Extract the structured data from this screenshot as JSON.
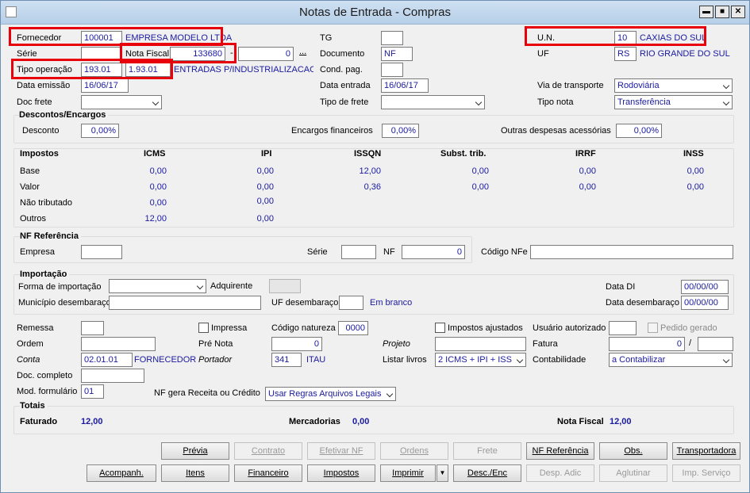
{
  "window": {
    "title": "Notas de Entrada - Compras",
    "min": "▬",
    "max": "■",
    "close": "✕"
  },
  "header": {
    "fornecedor_label": "Fornecedor",
    "fornecedor_code": "100001",
    "fornecedor_name": "EMPRESA MODELO LTDA",
    "serie_label": "Série",
    "serie_value": "",
    "nota_fiscal_label": "Nota Fiscal",
    "nota_fiscal_value": "133680",
    "nf_sep": "-",
    "nf_seq": "0",
    "ellipsis": "...",
    "tipo_operacao_label": "Tipo operação",
    "tipo_operacao_code": "193.01",
    "tipo_operacao_code2": "1.93.01",
    "tipo_operacao_desc": "ENTRADAS P/INDUSTRIALIZACAO P/",
    "data_emissao_label": "Data emissão",
    "data_emissao_value": "16/06/17",
    "doc_frete_label": "Doc frete",
    "doc_frete_value": "",
    "tg_label": "TG",
    "tg_value": "",
    "documento_label": "Documento",
    "documento_value": "NF",
    "cond_pag_label": "Cond. pag.",
    "cond_pag_value": "",
    "data_entrada_label": "Data entrada",
    "data_entrada_value": "16/06/17",
    "tipo_frete_label": "Tipo de frete",
    "tipo_frete_value": "",
    "un_label": "U.N.",
    "un_code": "10",
    "un_name": "CAXIAS DO SUL",
    "uf_label": "UF",
    "uf_code": "RS",
    "uf_name": "RIO GRANDE DO SUL",
    "via_transporte_label": "Via de transporte",
    "via_transporte_value": "Rodoviária",
    "tipo_nota_label": "Tipo nota",
    "tipo_nota_value": "Transferência"
  },
  "descontos": {
    "title": "Descontos/Encargos",
    "desconto_label": "Desconto",
    "desconto_value": "0,00%",
    "encargos_label": "Encargos financeiros",
    "encargos_value": "0,00%",
    "outras_label": "Outras despesas acessórias",
    "outras_value": "0,00%"
  },
  "impostos": {
    "title": "Impostos",
    "columns": [
      "ICMS",
      "IPI",
      "ISSQN",
      "Subst. trib.",
      "IRRF",
      "INSS"
    ],
    "row_labels": [
      "Base",
      "Valor",
      "Não tributado",
      "Outros"
    ],
    "rows": [
      [
        "0,00",
        "0,00",
        "12,00",
        "0,00",
        "0,00",
        "0,00"
      ],
      [
        "0,00",
        "0,00",
        "0,36",
        "0,00",
        "0,00",
        "0,00"
      ],
      [
        "0,00",
        "0,00"
      ],
      [
        "12,00",
        "0,00"
      ]
    ]
  },
  "nf_referencia": {
    "title": "NF Referência",
    "empresa_label": "Empresa",
    "empresa_value": "",
    "serie_label": "Série",
    "serie_value": "",
    "nf_label": "NF",
    "nf_value": "0",
    "codigo_nfe_label": "Código NFe",
    "codigo_nfe_value": ""
  },
  "importacao": {
    "title": "Importação",
    "forma_label": "Forma de importação",
    "forma_value": "",
    "adquirente_label": "Adquirente",
    "adquirente_value": "",
    "data_di_label": "Data DI",
    "data_di_value": "00/00/00",
    "municipio_label": "Município desembaraço",
    "municipio_value": "",
    "uf_desemb_label": "UF desembaraço",
    "uf_desemb_value": "",
    "uf_desemb_desc": "Em branco",
    "data_desemb_label": "Data desembaraço",
    "data_desemb_value": "00/00/00"
  },
  "misc": {
    "remessa_label": "Remessa",
    "remessa_value": "",
    "impressa_label": "Impressa",
    "codigo_natureza_label": "Código natureza",
    "codigo_natureza_value": "0000",
    "impostos_ajustados_label": "Impostos ajustados",
    "usuario_autorizado_label": "Usuário autorizado",
    "usuario_autorizado_value": "",
    "pedido_gerado_label": "Pedido gerado",
    "ordem_label": "Ordem",
    "ordem_value": "",
    "pre_nota_label": "Pré Nota",
    "pre_nota_value": "0",
    "projeto_label": "Projeto",
    "projeto_value": "",
    "fatura_label": "Fatura",
    "fatura_value": "0",
    "fatura_sep": "/",
    "fatura_value2": "",
    "conta_label": "Conta",
    "conta_value": "02.01.01",
    "conta_desc": "FORNECEDOR",
    "portador_label": "Portador",
    "portador_value": "341",
    "portador_desc": "ITAU",
    "listar_livros_label": "Listar livros",
    "listar_livros_value": "2 ICMS + IPI + ISS",
    "contabilidade_label": "Contabilidade",
    "contabilidade_value": "a Contabilizar",
    "doc_completo_label": "Doc. completo",
    "doc_completo_value": "",
    "mod_formulario_label": "Mod. formulário",
    "mod_formulario_value": "01",
    "nf_gera_label": "NF gera Receita ou Crédito",
    "nf_gera_value": "Usar Regras Arquivos Legais"
  },
  "totais": {
    "title": "Totais",
    "faturado_label": "Faturado",
    "faturado_value": "12,00",
    "mercadorias_label": "Mercadorias",
    "mercadorias_value": "0,00",
    "nota_fiscal_label": "Nota Fiscal",
    "nota_fiscal_value": "12,00"
  },
  "buttons": {
    "previa": "Prévia",
    "contrato": "Contrato",
    "efetivar_nf": "Efetivar NF",
    "ordens": "Ordens",
    "frete": "Frete",
    "nf_referencia": "NF Referência",
    "obs": "Obs.",
    "transportadora": "Transportadora",
    "acompanh": "Acompanh.",
    "itens": "Itens",
    "financeiro": "Financeiro",
    "impostos": "Impostos",
    "imprimir": "Imprimir",
    "desc_enc": "Desc./Enc",
    "desp_adic": "Desp. Adic",
    "aglutinar": "Aglutinar",
    "imp_servico": "Imp. Serviço"
  }
}
